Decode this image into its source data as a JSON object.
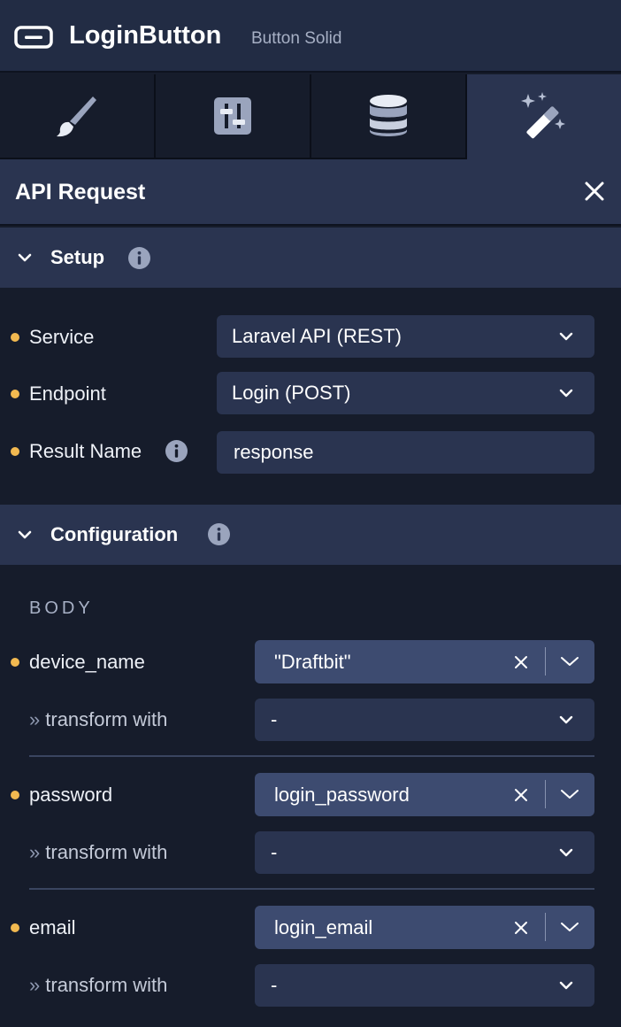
{
  "header": {
    "title": "LoginButton",
    "subtitle": "Button Solid",
    "component_icon": "button-outline-icon"
  },
  "tabs": [
    {
      "name": "style",
      "icon": "paintbrush-icon",
      "active": false
    },
    {
      "name": "config",
      "icon": "sliders-icon",
      "active": false
    },
    {
      "name": "data",
      "icon": "database-icon",
      "active": false
    },
    {
      "name": "actions",
      "icon": "magic-wand-icon",
      "active": true
    }
  ],
  "panel": {
    "title": "API Request"
  },
  "setup": {
    "title": "Setup",
    "fields": {
      "service": {
        "label": "Service",
        "value": "Laravel API (REST)"
      },
      "endpoint": {
        "label": "Endpoint",
        "value": "Login (POST)"
      },
      "result_name": {
        "label": "Result Name",
        "value": "response"
      }
    }
  },
  "configuration": {
    "title": "Configuration",
    "body_label": "BODY",
    "params": [
      {
        "name": "device_name",
        "value": "\"Draftbit\"",
        "transform_label": "transform with",
        "transform_value": "-"
      },
      {
        "name": "password",
        "value": "login_password",
        "transform_label": "transform with",
        "transform_value": "-"
      },
      {
        "name": "email",
        "value": "login_email",
        "transform_label": "transform with",
        "transform_value": "-"
      }
    ]
  },
  "colors": {
    "required_dot": "#f2b950",
    "panel": "#2a3450",
    "background": "#161c2b",
    "combo_fill": "#3d4b70"
  }
}
